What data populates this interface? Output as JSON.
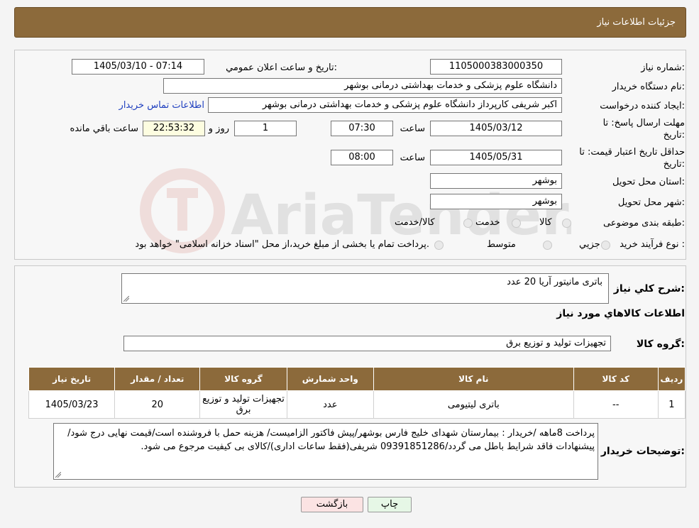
{
  "header": {
    "title": "جزئیات اطلاعات نیاز"
  },
  "form": {
    "need_number_label": "شماره نیاز:",
    "need_number": "1105000383000350",
    "announce_label": "تاریخ و ساعت اعلان عمومي:",
    "announce_value": "1405/03/10 - 07:14",
    "buyer_org_label": "نام دستگاه خريدار:",
    "buyer_org": "دانشگاه علوم پزشکی و خدمات بهداشتی درمانی بوشهر",
    "requester_label": "ايجاد کننده درخواست:",
    "requester": "اکبر شریفی کارپرداز دانشگاه علوم پزشکی و خدمات بهداشتی درمانی بوشهر",
    "contact_link": "اطلاعات تماس خريدار",
    "deadline_label_1": "مهلت ارسال پاسخ: تا",
    "deadline_label_2": "تاريخ:",
    "deadline_date": "1405/03/12",
    "time_label": "ساعت",
    "deadline_time": "07:30",
    "days_value": "1",
    "days_label": "روز و",
    "remaining_time": "22:53:32",
    "remaining_label": "ساعت باقي مانده",
    "validity_label_1": "حداقل تاريخ اعتبار قيمت: تا",
    "validity_label_2": "تاريخ:",
    "validity_date": "1405/05/31",
    "validity_time_label": "ساعت",
    "validity_time": "08:00",
    "province_label": "استان محل تحويل:",
    "province": "بوشهر",
    "city_label": "شهر محل تحويل:",
    "city": "بوشهر",
    "category_label": "طبقه بندی موضوعی:",
    "category_options": [
      "کالا",
      "خدمت",
      "کالا/خدمت"
    ],
    "process_label": "نوع فرآيند خريد :",
    "process_options": [
      "جزيي",
      "متوسط"
    ],
    "process_note": "پرداخت تمام يا بخشی از مبلغ خريد،از محل \"اسناد خزانه اسلامی\" خواهد بود."
  },
  "summary": {
    "label": "شرح کلي نياز:",
    "value": "باتری مانیتور آریا 20 عدد"
  },
  "goods_info_title": "اطلاعات کالاهاي مورد نياز",
  "goods_group": {
    "label": "گروه کالا:",
    "value": "تجهیزات تولید و توزیع برق"
  },
  "table": {
    "headers": [
      "رديف",
      "کد کالا",
      "نام کالا",
      "واحد شمارش",
      "گروه کالا",
      "تعداد / مقدار",
      "تاريخ نياز"
    ],
    "rows": [
      [
        "1",
        "--",
        "باتری لیتیومی",
        "عدد",
        "تجهیزات تولید و توزیع برق",
        "20",
        "1405/03/23"
      ]
    ]
  },
  "buyer_notes": {
    "label": "توضيحات خريدار:",
    "value": "پرداخت 8ماهه /خریدار : بیمارستان شهدای خلیج فارس بوشهر/پیش فاکتور الزامیست/ هزینه حمل با فروشنده است/قیمت نهایی درج شود/پیشنهادات فاقد شرایط باطل می گردد/09391851286 شریفی(فقط ساعات اداری)/کالای بی کیفیت مرجوع می شود."
  },
  "buttons": {
    "print": "چاپ",
    "back": "بازگشت"
  },
  "watermark": "AriaTender.neT",
  "colors": {
    "header_bg": "#8c6a3b",
    "link": "#1f3fbf",
    "back_button_bg": "#fbe3e3",
    "print_button_bg": "#e6f7e6"
  }
}
